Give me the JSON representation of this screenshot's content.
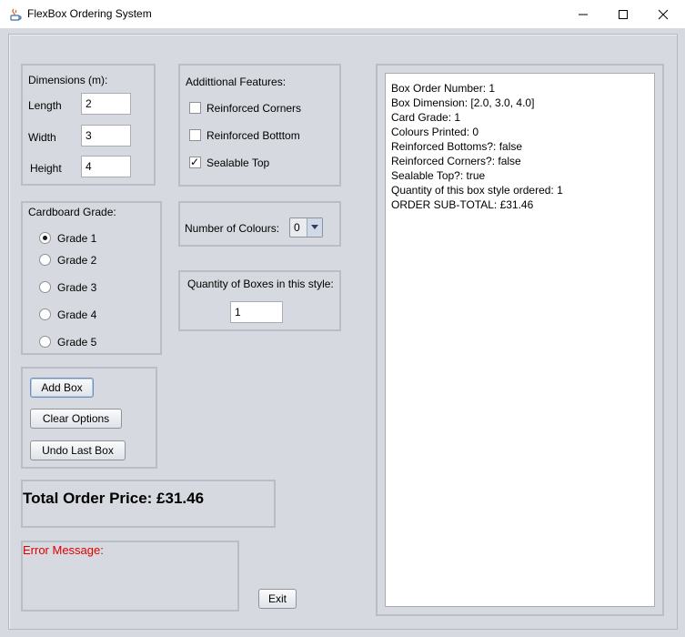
{
  "window": {
    "title": "FlexBox Ordering System"
  },
  "dimensions": {
    "heading": "Dimensions (m):",
    "length_label": "Length",
    "length_value": "2",
    "width_label": "Width",
    "width_value": "3",
    "height_label": "Height",
    "height_value": "4"
  },
  "features": {
    "heading": "Addittional Features:",
    "items": [
      {
        "label": "Reinforced Corners",
        "checked": false
      },
      {
        "label": "Reinforced Botttom",
        "checked": false
      },
      {
        "label": "Sealable Top",
        "checked": true
      }
    ]
  },
  "grade": {
    "heading": "Cardboard Grade:",
    "options": [
      "Grade 1",
      "Grade 2",
      "Grade 3",
      "Grade 4",
      "Grade 5"
    ],
    "selected": "Grade 1"
  },
  "colours": {
    "label": "Number of Colours:",
    "value": "0"
  },
  "quantity": {
    "label": "Quantity of Boxes in this style:",
    "value": "1"
  },
  "buttons": {
    "add": "Add Box",
    "clear": "Clear Options",
    "undo": "Undo Last Box",
    "exit": "Exit"
  },
  "total": {
    "text": "Total Order Price: £31.46"
  },
  "error": {
    "label": "Error Message:",
    "color": "#e00000"
  },
  "order_summary": [
    "Box Order Number: 1",
    "Box Dimension: [2.0, 3.0, 4.0]",
    "Card Grade: 1",
    "Colours Printed: 0",
    "Reinforced Bottoms?: false",
    "Reinforced Corners?: false",
    "Sealable Top?: true",
    "Quantity of this box style ordered: 1",
    "ORDER SUB-TOTAL: £31.46"
  ]
}
